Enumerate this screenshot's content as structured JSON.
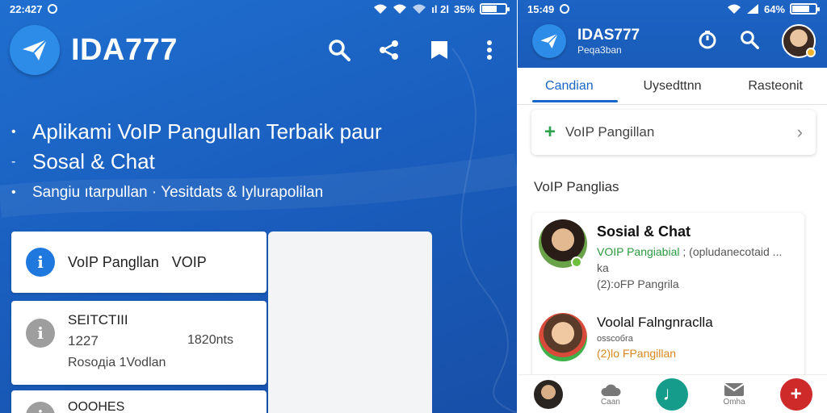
{
  "left": {
    "status": {
      "time": "22:427",
      "battery": "35%",
      "signal": "ıl 2l"
    },
    "app_title": "IDA777",
    "bullets": [
      {
        "marker": "•",
        "text": "Aplikami VoIP Pangullan Terbaik paur"
      },
      {
        "marker": "-",
        "text": "Sosal & Chat"
      },
      {
        "marker": "•",
        "text": "Sangiu ıtarpullan · Yesitdats & Iyluraрolіlan"
      }
    ],
    "cards": [
      {
        "icon_letter": "i",
        "title": "VoIP Pangllan",
        "tag": "VOIP"
      },
      {
        "icon_letter": "i",
        "title": "SEITCTIII",
        "number": "1227",
        "size": "1820nts",
        "subtitle": "Rosoдia 1Vodlan"
      },
      {
        "icon_letter": "i",
        "title": "OOOHES"
      }
    ]
  },
  "right": {
    "status": {
      "time": "15:49",
      "battery": "64%"
    },
    "app_title": "IDAS777",
    "app_subtitle": "Peqa3ban",
    "tabs": [
      {
        "label": "Candian",
        "active": true
      },
      {
        "label": "Uysedttnn",
        "active": false
      },
      {
        "label": "Rasteonit",
        "active": false
      }
    ],
    "search_card": {
      "label": "VoIP Pangillan"
    },
    "section_title": "VoIP Panglias",
    "contacts": [
      {
        "name": "Sosial & Chat",
        "line1": "VOIP Pangiabial",
        "line1_rest": "; (opludanecotaid ...",
        "line2": "ka",
        "line3": "(2):oFP Pangrila"
      },
      {
        "name": "Voolal Falngnraclla",
        "line1": "osscoбra",
        "line2": "(2)lo FPangillan"
      }
    ],
    "bottom_nav": [
      {
        "label": ""
      },
      {
        "label": "Caan"
      },
      {
        "label": ""
      },
      {
        "label": "Omha"
      },
      {
        "label": ""
      }
    ]
  },
  "colors": {
    "brand_blue": "#1f6fd0",
    "accent_green": "#2a9a3e",
    "accent_orange": "#d7881f",
    "fab_teal": "#159c8a",
    "fab_red": "#cf2a2a"
  },
  "icons": [
    "send-logo-icon",
    "search-icon",
    "share-icon",
    "bookmark-icon",
    "more-vert-icon",
    "timer-icon",
    "wifi-icon",
    "battery-icon",
    "plus-icon",
    "chevron-right-icon",
    "cloud-icon",
    "mail-icon",
    "music-note-icon",
    "add-icon"
  ]
}
